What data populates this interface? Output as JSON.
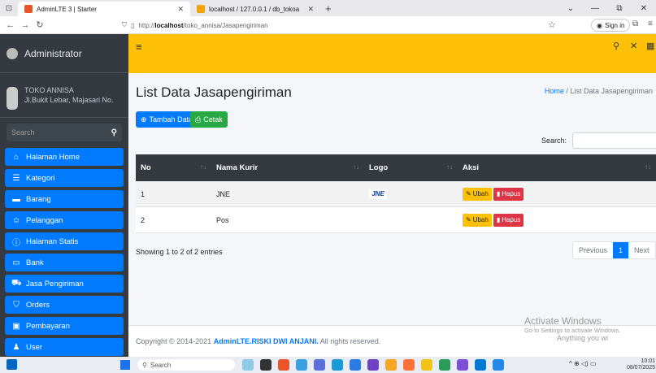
{
  "browser": {
    "tabs": [
      {
        "title": "AdminLTE 3 | Starter"
      },
      {
        "title": "localhost / 127.0.0.1 / db_tokoa"
      }
    ],
    "url_prefix": "http://",
    "url_host": "localhost",
    "url_path": "/toko_annisa/Jasapengiriman",
    "sign_in": "Sign in"
  },
  "brand": {
    "name": "Administrator"
  },
  "user": {
    "name": "TOKO ANNISA",
    "address": "Jl.Bukit Lebar, Majasari No."
  },
  "sidebar": {
    "search_placeholder": "Search",
    "items": [
      {
        "label": "Halaman Home",
        "icon": "home-icon"
      },
      {
        "label": "Kategori",
        "icon": "list-icon"
      },
      {
        "label": "Barang",
        "icon": "box-icon"
      },
      {
        "label": "Pelanggan",
        "icon": "users-icon"
      },
      {
        "label": "Halaman Statis",
        "icon": "info-icon"
      },
      {
        "label": "Bank",
        "icon": "bank-icon"
      },
      {
        "label": "Jasa Pengiriman",
        "icon": "truck-icon"
      },
      {
        "label": "Orders",
        "icon": "cart-icon"
      },
      {
        "label": "Pembayaran",
        "icon": "money-icon"
      },
      {
        "label": "User",
        "icon": "user-icon"
      }
    ]
  },
  "page": {
    "title": "List Data Jasapengiriman",
    "breadcrumb_home": "Home",
    "breadcrumb_sep": "/",
    "breadcrumb_current": "List Data Jasapengiriman",
    "add_button": "Tambah Data",
    "print_button": "Cetak",
    "search_label": "Search:"
  },
  "table": {
    "headers": [
      "No",
      "Nama Kurir",
      "Logo",
      "Aksi"
    ],
    "rows": [
      {
        "no": "1",
        "nama": "JNE",
        "logo": "JNE"
      },
      {
        "no": "2",
        "nama": "Pos",
        "logo": ""
      }
    ],
    "edit_label": "Ubah",
    "delete_label": "Hapus"
  },
  "pagination": {
    "info": "Showing 1 to 2 of 2 entries",
    "previous": "Previous",
    "current": "1",
    "next": "Next"
  },
  "footer": {
    "prefix": "Copyright © 2014-2021 ",
    "company": "AdminLTE.RISKI DWI ANJANI.",
    "suffix": " All rights reserved."
  },
  "watermark": {
    "line1": "Activate Windows",
    "line2": "Go to Settings to activate Windows.",
    "line3": "Anything you wi"
  },
  "taskbar": {
    "search": "Search",
    "time": "10:01",
    "date": "08/07/2025"
  },
  "colors": {
    "navbar": "#ffc107",
    "sidebar": "#343a40",
    "menu_item": "#007bff",
    "add_button": "#007bff",
    "print_button": "#28a745"
  }
}
